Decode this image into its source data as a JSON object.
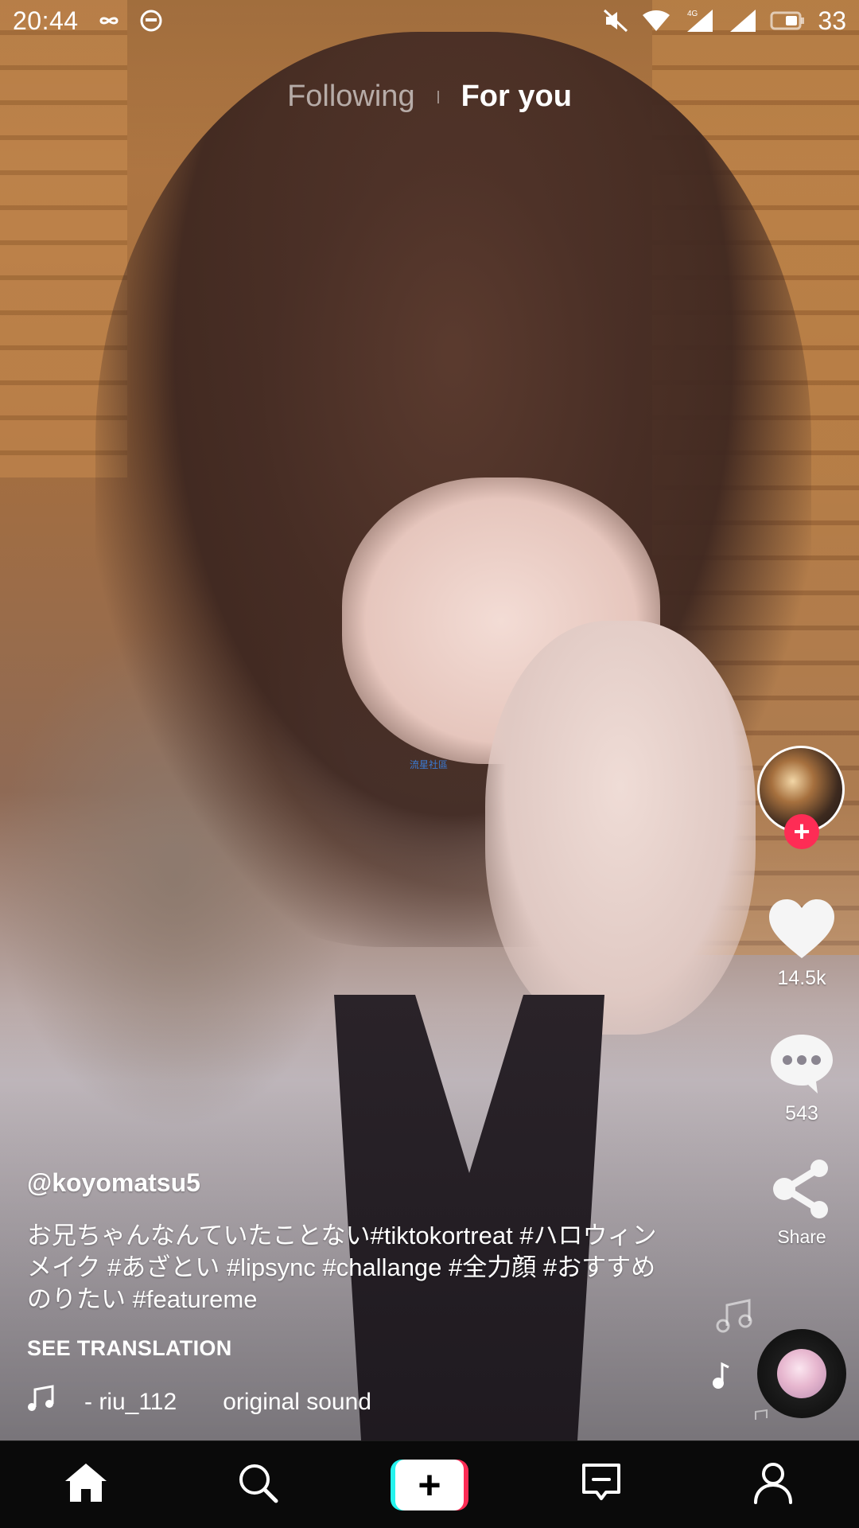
{
  "status_bar": {
    "time": "20:44",
    "battery_level": "33",
    "icons": [
      "infinity-icon",
      "circle-face-icon",
      "mute-icon",
      "wifi-icon",
      "network-4g-icon",
      "signal-icon",
      "battery-icon"
    ]
  },
  "top_tabs": {
    "following": "Following",
    "for_you": "For you",
    "active": "For you"
  },
  "video": {
    "watermark_text": "流星社區"
  },
  "right_rail": {
    "likes": "14.5k",
    "comments": "543",
    "share_label": "Share"
  },
  "caption": {
    "username": "@koyomatsu5",
    "description": "お兄ちゃんなんていたことない#tiktokortreat #ハロウィンメイク #あざとい #lipsync #challange #全力顔 #おすすめのりたい #featureme",
    "see_translation": "SEE TRANSLATION"
  },
  "sound": {
    "user": "- riu_112",
    "name": "original sound"
  },
  "bottom_nav": {
    "items": [
      "home-icon",
      "search-icon",
      "create-button",
      "inbox-icon",
      "profile-icon"
    ]
  },
  "colors": {
    "accent_red": "#fe2c55",
    "accent_cyan": "#25f4ee",
    "nav_bg": "#0a0a0a"
  }
}
